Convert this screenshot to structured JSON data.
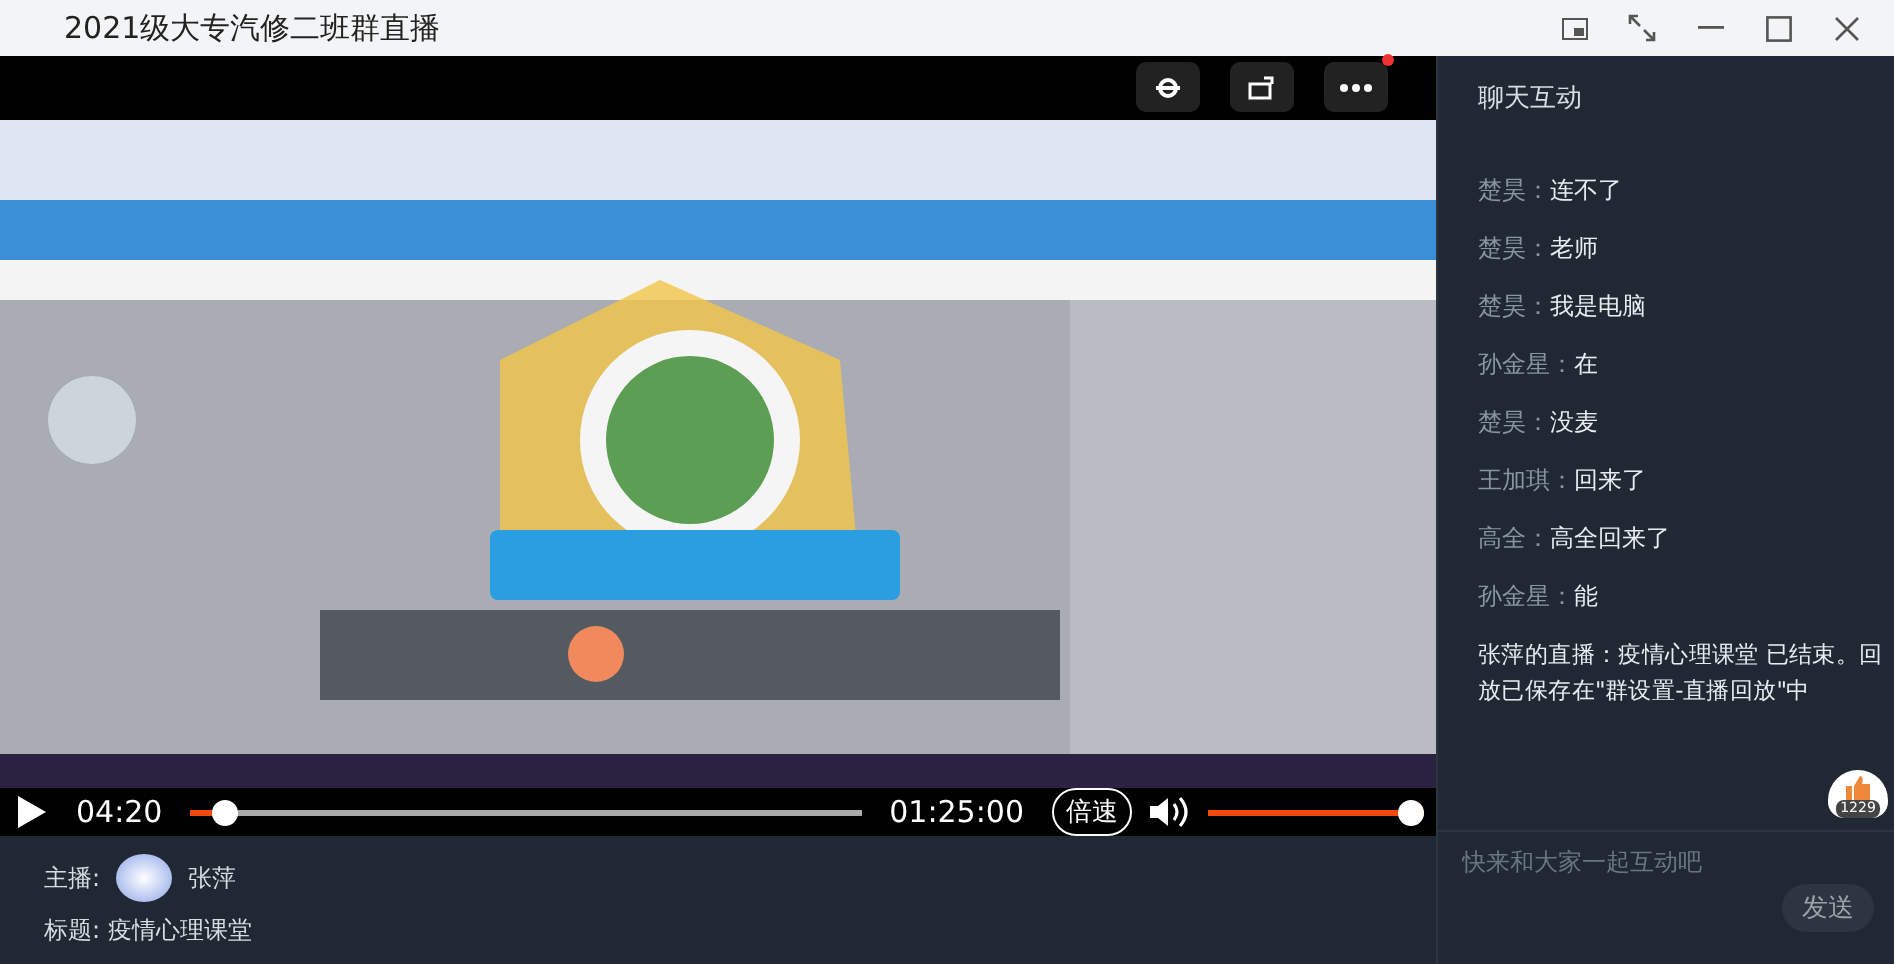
{
  "window": {
    "title": "2021级大专汽修二班群直播"
  },
  "player": {
    "current_time": "04:20",
    "duration": "01:25:00",
    "progress": {
      "level": 0.05
    },
    "speed_button": "倍速",
    "volume": {
      "level": 1.0
    },
    "more_badge": true
  },
  "info": {
    "host_label": "主播:",
    "host_name": "张萍",
    "title_label": "标题:",
    "title": "疫情心理课堂"
  },
  "chat": {
    "title": "聊天互动",
    "messages": [
      {
        "sender": "楚昊：",
        "text": "连不了"
      },
      {
        "sender": "楚昊：",
        "text": "老师"
      },
      {
        "sender": "楚昊：",
        "text": "我是电脑"
      },
      {
        "sender": "孙金星：",
        "text": "在"
      },
      {
        "sender": "楚昊：",
        "text": "没麦"
      },
      {
        "sender": "王加琪：",
        "text": "回来了"
      },
      {
        "sender": "高全：",
        "text": "高全回来了"
      },
      {
        "sender": "孙金星：",
        "text": "能"
      }
    ],
    "notice": "张萍的直播：疫情心理课堂 已结束。回放已保存在\"群设置-直播回放\"中",
    "likes": "1229",
    "input": {
      "placeholder": "快来和大家一起互动吧"
    },
    "send_button": "发送"
  }
}
